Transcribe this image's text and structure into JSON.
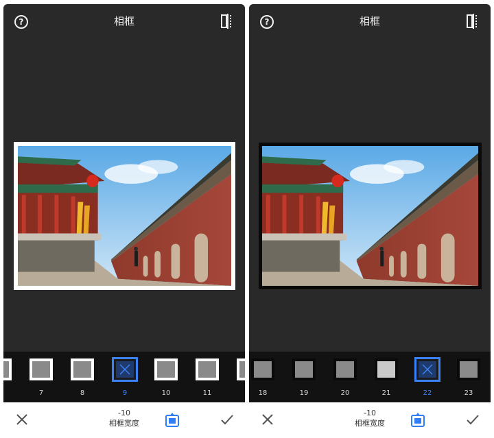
{
  "screens": [
    {
      "title": "相框",
      "help_icon": "?",
      "slider": {
        "value": "-10",
        "label": "相框宽度"
      },
      "thumbnails": [
        {
          "label": "",
          "style": "white"
        },
        {
          "label": "7",
          "style": "white"
        },
        {
          "label": "8",
          "style": "white"
        },
        {
          "label": "9",
          "style": "selected"
        },
        {
          "label": "10",
          "style": "white"
        },
        {
          "label": "11",
          "style": "white"
        },
        {
          "label": "",
          "style": "white"
        }
      ],
      "frame_color": "#ffffff"
    },
    {
      "title": "相框",
      "help_icon": "?",
      "slider": {
        "value": "-10",
        "label": "相框宽度"
      },
      "thumbnails": [
        {
          "label": "18",
          "style": "black"
        },
        {
          "label": "19",
          "style": "black"
        },
        {
          "label": "20",
          "style": "black"
        },
        {
          "label": "21",
          "style": "black"
        },
        {
          "label": "22",
          "style": "selected"
        },
        {
          "label": "23",
          "style": "black"
        }
      ],
      "frame_color": "#0a0a0a"
    }
  ],
  "colors": {
    "accent": "#3b82f6",
    "app_background": "#292929",
    "strip_background": "#121212",
    "bottom_bar": "#ffffff"
  },
  "icons": {
    "help": "help-icon",
    "compare": "compare-icon",
    "cancel": "close-icon",
    "confirm": "check-icon",
    "frame_width": "frame-width-icon"
  }
}
